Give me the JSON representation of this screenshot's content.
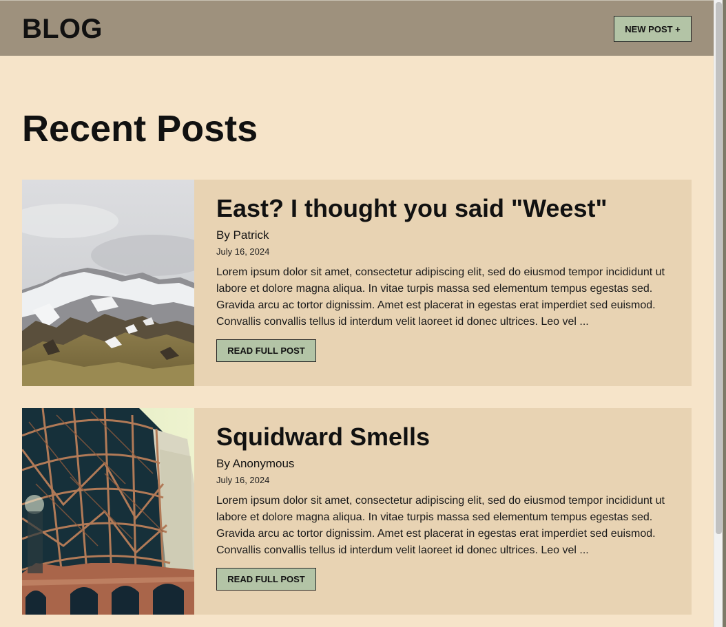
{
  "header": {
    "brand": "BLOG",
    "new_post_label": "NEW POST +"
  },
  "page": {
    "title": "Recent Posts"
  },
  "posts": [
    {
      "title": "East? I thought you said \"Weest\"",
      "author": "By Patrick",
      "date": "July 16, 2024",
      "excerpt": "Lorem ipsum dolor sit amet, consectetur adipiscing elit, sed do eiusmod tempor incididunt ut labore et dolore magna aliqua. In vitae turpis massa sed elementum tempus egestas sed. Gravida arcu ac tortor dignissim. Amet est placerat in egestas erat imperdiet sed euismod. Convallis convallis tellus id interdum velit laoreet id donec ultrices. Leo vel ...",
      "button_label": "READ FULL POST",
      "image": "snowy-mountain-photo"
    },
    {
      "title": "Squidward Smells",
      "author": "By Anonymous",
      "date": "July 16, 2024",
      "excerpt": "Lorem ipsum dolor sit amet, consectetur adipiscing elit, sed do eiusmod tempor incididunt ut labore et dolore magna aliqua. In vitae turpis massa sed elementum tempus egestas sed. Gravida arcu ac tortor dignissim. Amet est placerat in egestas erat imperdiet sed euismod. Convallis convallis tellus id interdum velit laoreet id donec ultrices. Leo vel ...",
      "button_label": "READ FULL POST",
      "image": "steel-arch-building-photo"
    }
  ],
  "colors": {
    "page_bg": "#f6e4c9",
    "header_bg": "#9e917d",
    "card_bg": "#e8d3b3",
    "button_bg": "#b3c4a6"
  }
}
